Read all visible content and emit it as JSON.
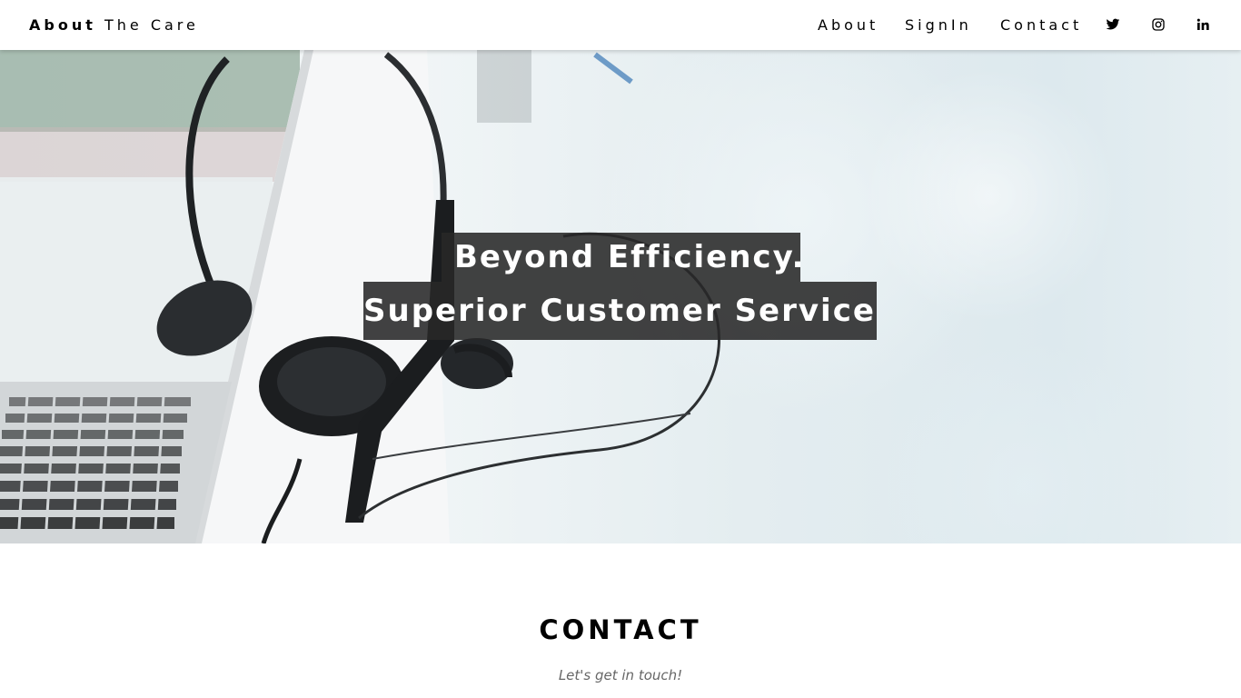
{
  "header": {
    "brand_bold": "About",
    "brand_rest": "The Care",
    "nav": {
      "about": "About",
      "signin": "SignIn",
      "contact": "Contact"
    },
    "social_icons": [
      "twitter-icon",
      "instagram-icon",
      "linkedin-icon"
    ]
  },
  "hero": {
    "headline_line1": "Beyond Efficiency.",
    "headline_line2": "Superior Customer Service",
    "image_subject": "headset resting on laptop"
  },
  "contact": {
    "title": "CONTACT",
    "subtitle": "Let's get in touch!"
  },
  "colors": {
    "header_bg": "#ffffff",
    "headline_box": "#282828",
    "headline_text": "#ffffff",
    "subtitle_text": "#666666"
  }
}
